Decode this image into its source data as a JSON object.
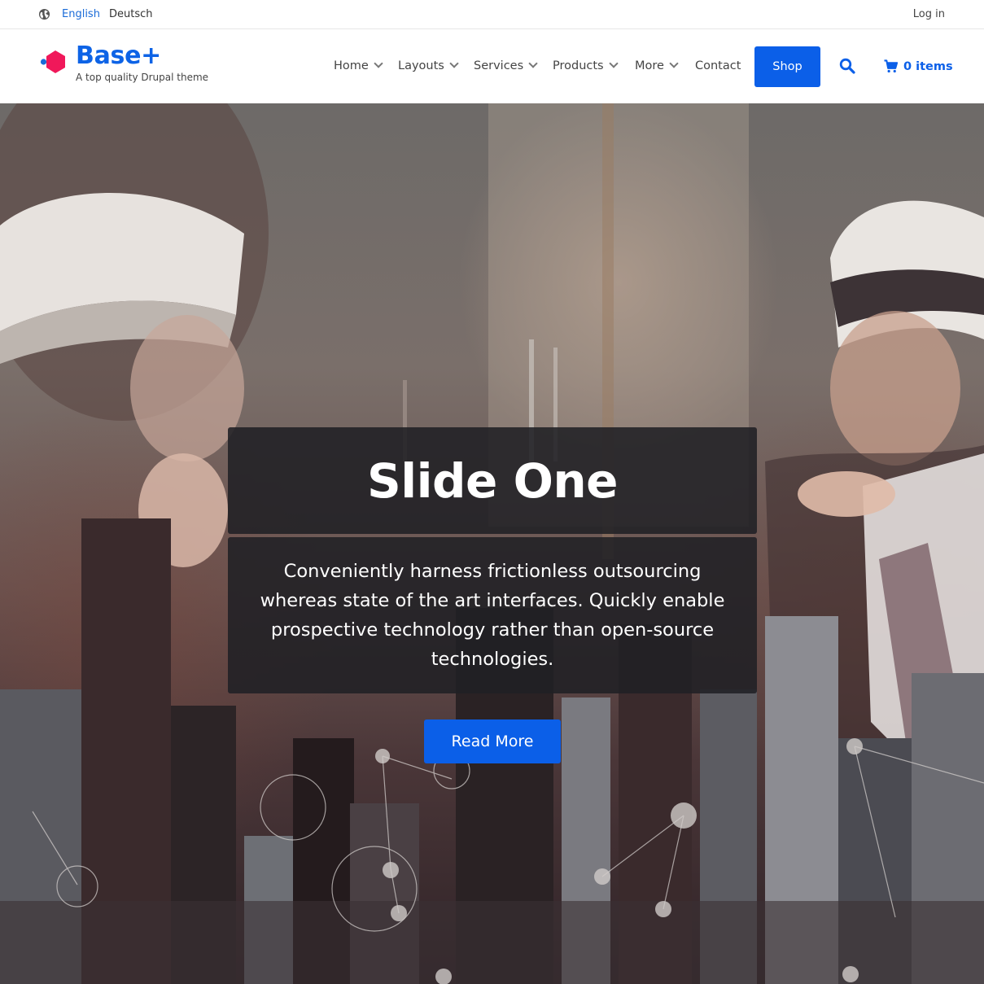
{
  "topbar": {
    "languages": [
      {
        "label": "English",
        "active": true
      },
      {
        "label": "Deutsch",
        "active": false
      }
    ],
    "login_label": "Log in",
    "globe_icon": "globe-icon"
  },
  "header": {
    "site_name": "Base+",
    "site_slogan": "A top quality Drupal theme",
    "logo_icon": "hexagon-logo",
    "nav": [
      {
        "label": "Home",
        "has_dropdown": true
      },
      {
        "label": "Layouts",
        "has_dropdown": true
      },
      {
        "label": "Services",
        "has_dropdown": true
      },
      {
        "label": "Products",
        "has_dropdown": true
      },
      {
        "label": "More",
        "has_dropdown": true
      },
      {
        "label": "Contact",
        "has_dropdown": false
      }
    ],
    "shop_label": "Shop",
    "search_icon": "search-icon",
    "cart_icon": "shopping-cart-icon",
    "cart_label": "0 items"
  },
  "hero": {
    "title": "Slide One",
    "text": "Conveniently harness frictionless outsourcing whereas state of the art interfaces. Quickly enable prospective technology rather than open-source technologies.",
    "button_label": "Read More"
  },
  "colors": {
    "accent": "#0b5fe8",
    "logo_pink": "#f0185a",
    "link_active": "#1a6bd8"
  }
}
